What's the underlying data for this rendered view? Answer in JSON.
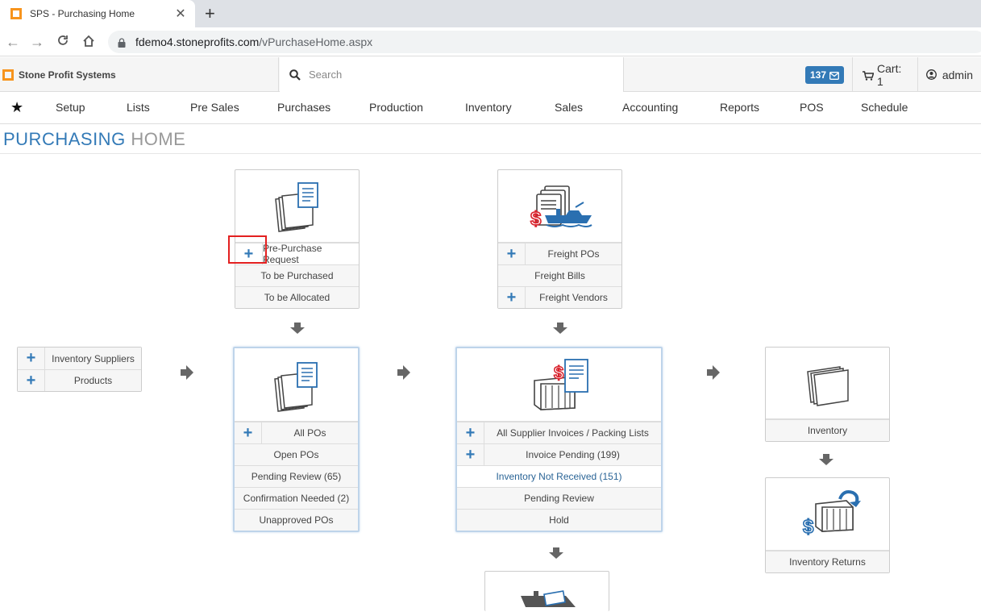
{
  "browser": {
    "tab_title": "SPS - Purchasing Home",
    "url_host": "fdemo4.stoneprofits.com",
    "url_path": "/vPurchaseHome.aspx"
  },
  "header": {
    "brand": "Stone Profit Systems",
    "search_placeholder": "Search",
    "notifications": "137",
    "cart": "Cart: 1",
    "user": "admin"
  },
  "nav": {
    "items": [
      "Setup",
      "Lists",
      "Pre Sales",
      "Purchases",
      "Production",
      "Inventory",
      "Sales",
      "Accounting",
      "Reports",
      "POS",
      "Schedule"
    ]
  },
  "page": {
    "title_part1": "PURCHASING",
    "title_part2": "HOME"
  },
  "supplier_box": {
    "rows": [
      "Inventory Suppliers",
      "Products"
    ]
  },
  "prepurchase_card": {
    "rows": [
      "Pre-Purchase Request",
      "To be Purchased",
      "To be Allocated"
    ]
  },
  "freight_card": {
    "rows": [
      "Freight POs",
      "Freight Bills",
      "Freight Vendors"
    ]
  },
  "po_card": {
    "rows": [
      "All POs",
      "Open POs",
      "Pending Review (65)",
      "Confirmation Needed (2)",
      "Unapproved POs"
    ]
  },
  "invoice_card": {
    "rows": [
      "All Supplier Invoices / Packing Lists",
      "Invoice Pending (199)",
      "Inventory Not Received (151)",
      "Pending Review",
      "Hold"
    ]
  },
  "inventory_card": {
    "label": "Inventory"
  },
  "returns_card": {
    "label": "Inventory Returns"
  },
  "colors": {
    "accent": "#337ab7",
    "brand_orange": "#f7941d",
    "highlight_red": "#e32020"
  }
}
